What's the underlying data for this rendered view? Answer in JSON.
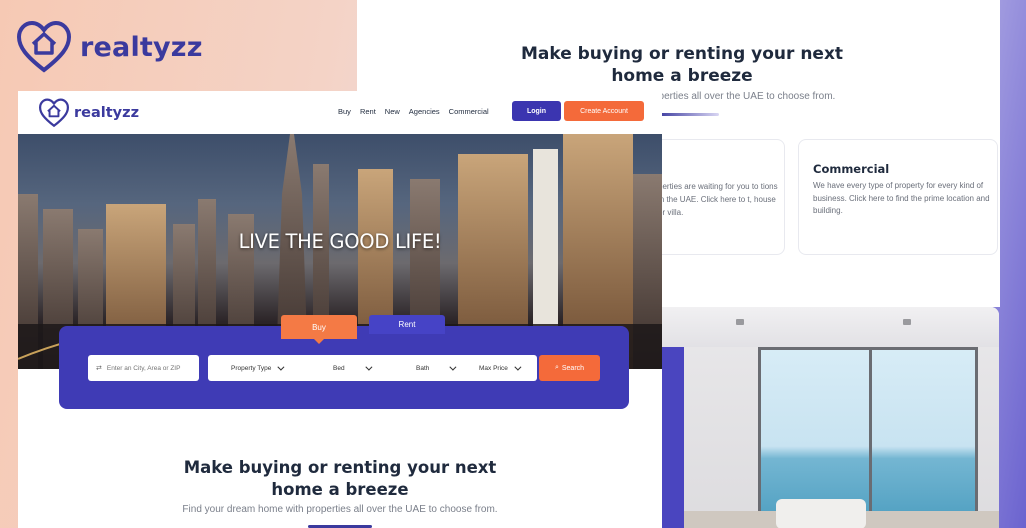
{
  "brand": {
    "name": "realtyzz",
    "color": "#3b3a9e",
    "accent": "#f46a3a"
  },
  "back_page": {
    "heading": "Make buying or renting your next home a breeze",
    "subtitle_partial": "operties all over the UAE to choose from.",
    "card_partial_text": "perties are waiting for you to tions in the UAE. Click here to t, house or villa.",
    "commercial": {
      "title": "Commercial",
      "text": "We have every type of property for every kind of business. Click here to find the prime location and building."
    }
  },
  "nav": {
    "links": [
      "Buy",
      "Rent",
      "New",
      "Agencies",
      "Commercial"
    ],
    "login_label": "Login",
    "create_account_label": "Create Account"
  },
  "hero": {
    "title": "LIVE THE GOOD LIFE!"
  },
  "search": {
    "tabs": {
      "buy": "Buy",
      "rent": "Rent"
    },
    "location_placeholder": "Enter an City, Area or ZIP",
    "filters": [
      "Property Type",
      "Bed",
      "Bath",
      "Max Price"
    ],
    "search_label": "Search"
  },
  "section": {
    "heading": "Make buying or renting your next home a breeze",
    "subtitle": "Find your dream home with properties all over the UAE to choose from."
  }
}
